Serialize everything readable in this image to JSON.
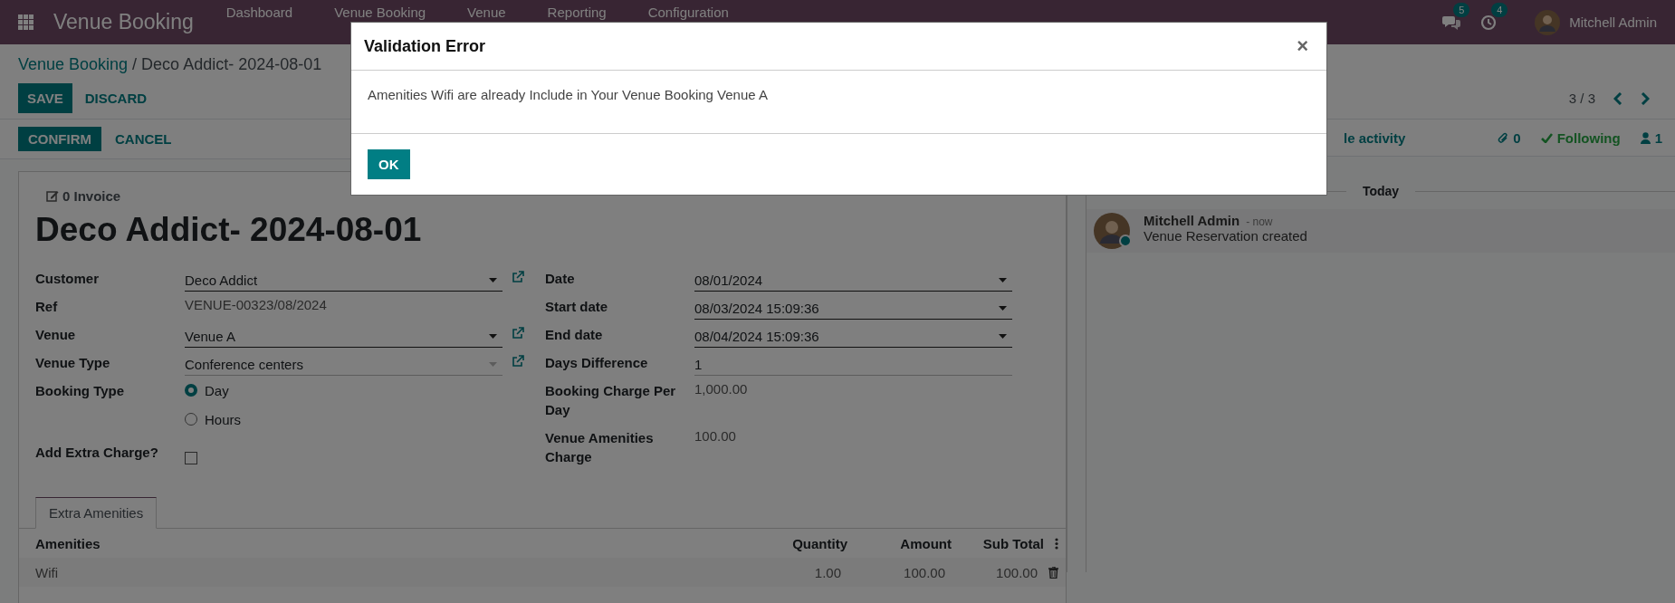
{
  "navbar": {
    "brand": "Venue Booking",
    "menu": [
      "Dashboard",
      "Venue Booking",
      "Venue",
      "Reporting",
      "Configuration"
    ],
    "messages_count": "5",
    "activities_count": "4",
    "user": "Mitchell Admin"
  },
  "breadcrumb": {
    "parent": "Venue Booking",
    "current": "/ Deco Addict- 2024-08-01"
  },
  "actions": [
    "SAVE",
    "DISCARD"
  ],
  "pager": "3 / 3",
  "status_buttons": [
    "CONFIRM",
    "CANCEL"
  ],
  "chatter_bar": {
    "schedule": "le activity",
    "attachments": "0",
    "follow": "Following",
    "followers": "1"
  },
  "form": {
    "smart_button": "0 Invoice",
    "title": "Deco Addict- 2024-08-01",
    "left_fields": [
      {
        "label": "Customer",
        "kind": "many2one",
        "value": "Deco Addict",
        "disabled": false
      },
      {
        "label": "Ref",
        "kind": "readonly",
        "value": "VENUE-00323/08/2024"
      },
      {
        "label": "Venue",
        "kind": "many2one",
        "value": "Venue A",
        "disabled": false
      },
      {
        "label": "Venue Type",
        "kind": "many2one",
        "value": "Conference centers",
        "disabled": true
      },
      {
        "label": "Booking Type",
        "kind": "radio",
        "options": [
          {
            "label": "Day",
            "selected": true
          },
          {
            "label": "Hours",
            "selected": false
          }
        ]
      },
      {
        "label": "Add Extra Charge?",
        "kind": "checkbox",
        "checked": false
      }
    ],
    "right_fields": [
      {
        "label": "Date",
        "kind": "date",
        "value": "08/01/2024"
      },
      {
        "label": "Start date",
        "kind": "date",
        "value": "08/03/2024 15:09:36"
      },
      {
        "label": "End date",
        "kind": "date",
        "value": "08/04/2024 15:09:36"
      },
      {
        "label": "Days Difference",
        "kind": "integer",
        "value": "1"
      },
      {
        "label": "Booking Charge Per Day",
        "kind": "readonly",
        "value": "1,000.00"
      },
      {
        "label": "Venue Amenities Charge",
        "kind": "readonly",
        "value": "100.00"
      }
    ],
    "tabs": [
      {
        "label": "Extra Amenities",
        "selected": true
      }
    ],
    "table": {
      "columns": [
        "Amenities",
        "Quantity",
        "Amount",
        "Sub Total"
      ],
      "rows": [
        {
          "cells": [
            "Wifi",
            "1.00",
            "100.00",
            "100.00"
          ]
        }
      ]
    }
  },
  "chatter": {
    "separator": "Today",
    "messages": [
      {
        "author": "Mitchell Admin",
        "time": "- now",
        "body": "Venue Reservation created",
        "online": true
      }
    ]
  },
  "dialog": {
    "title": "Validation Error",
    "close": "×",
    "body": "Amenities Wifi are already Include in Your Venue Booking Venue A",
    "button": "OK"
  }
}
